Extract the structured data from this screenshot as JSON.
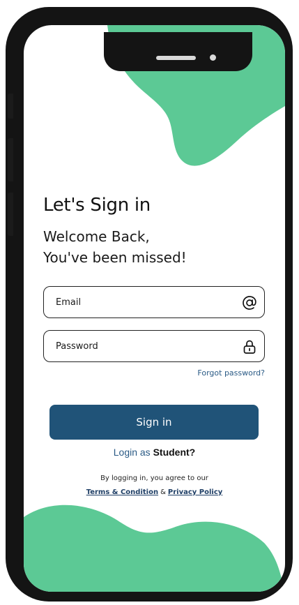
{
  "colors": {
    "accent_green": "#5cc995",
    "primary_blue": "#205378",
    "link_blue": "#2a5a85",
    "frame": "#141414"
  },
  "title": "Let's Sign in",
  "welcome": {
    "line1": "Welcome Back,",
    "line2": "You've been missed!"
  },
  "email_field": {
    "placeholder": "Email",
    "value": "",
    "icon": "at-sign-icon"
  },
  "password_field": {
    "placeholder": "Password",
    "value": "",
    "icon": "lock-icon"
  },
  "forgot_password": "Forgot password?",
  "sign_in_button": "Sign in",
  "login_as": {
    "prefix": "Login as",
    "role": "Student?"
  },
  "terms": {
    "text": "By logging in, you agree to our",
    "terms_link": "Terms & Condition",
    "ampersand": "&",
    "privacy_link": "Privacy Policy"
  }
}
